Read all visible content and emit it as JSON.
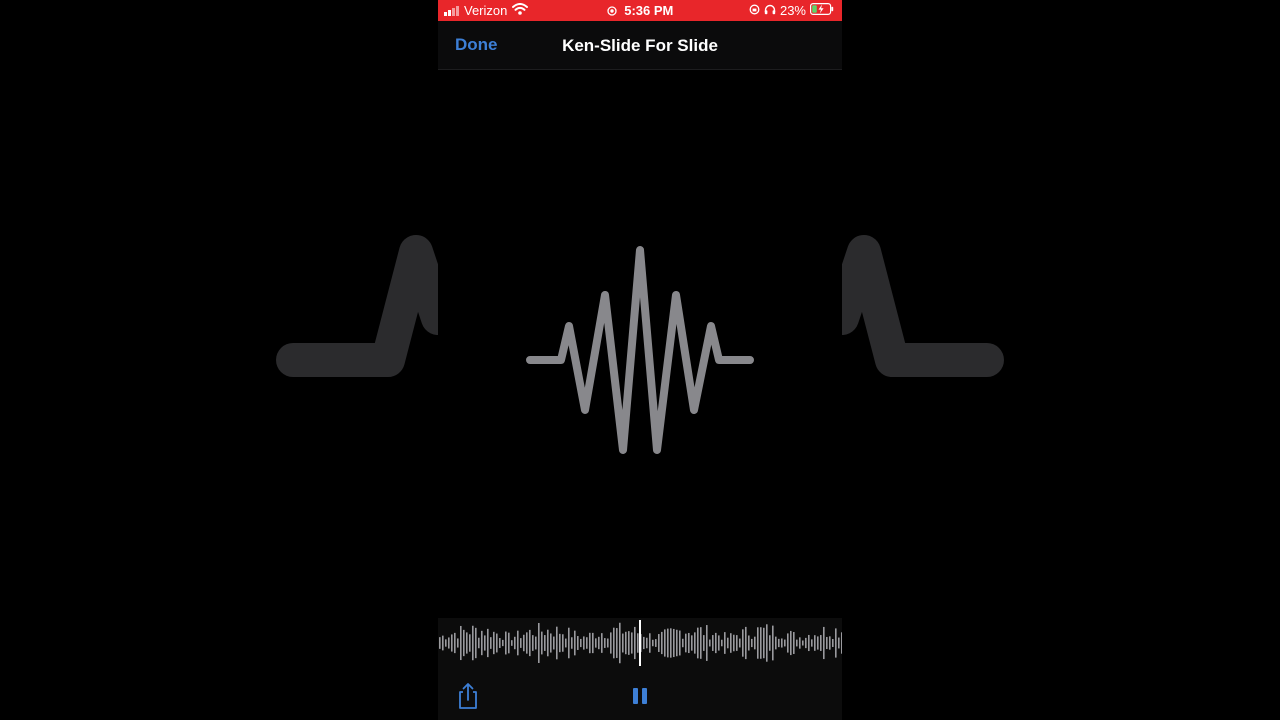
{
  "status_bar": {
    "carrier": "Verizon",
    "time": "5:36 PM",
    "battery": "23%",
    "background_color": "#e8262a"
  },
  "nav": {
    "done_label": "Done",
    "title": "Ken-Slide For Slide",
    "accent_color": "#3d7fd6"
  },
  "icons": {
    "wifi": "wifi-icon",
    "location": "location-icon",
    "lock_rotation": "rotation-lock-icon",
    "headphones": "headphones-icon",
    "battery": "battery-charging-icon",
    "artwork": "waveform-icon",
    "share": "share-icon",
    "pause": "pause-icon"
  },
  "playback": {
    "state": "playing",
    "playhead_position": 0.5
  }
}
